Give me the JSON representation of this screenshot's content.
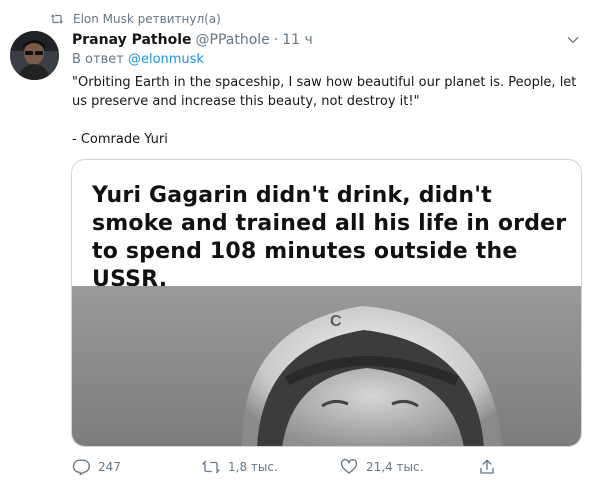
{
  "retweet_banner": {
    "text": "Elon Musk ретвитнул(а)",
    "icon": "retweet-icon"
  },
  "tweet": {
    "author_name": "Pranay Pathole",
    "handle": "@PPathole",
    "separator": "·",
    "time": "11 ч",
    "reply_prefix": "В ответ",
    "reply_mention": "@elonmusk",
    "text_line1": "\"Orbiting Earth in the spaceship, I saw how beautiful our planet is. People, let us preserve and increase this beauty, not destroy it!\"",
    "text_line2": "- Comrade Yuri",
    "media": {
      "caption": "Yuri Gagarin didn't drink, didn't smoke and trained all his life  in order to spend 108 minutes outside the USSR."
    },
    "actions": {
      "reply_count": "247",
      "retweet_count": "1,8 тыс.",
      "like_count": "21,4 тыс."
    }
  },
  "colors": {
    "link": "#1b95e0",
    "muted": "#657786",
    "text": "#14171a",
    "border": "#ccd6dd"
  }
}
